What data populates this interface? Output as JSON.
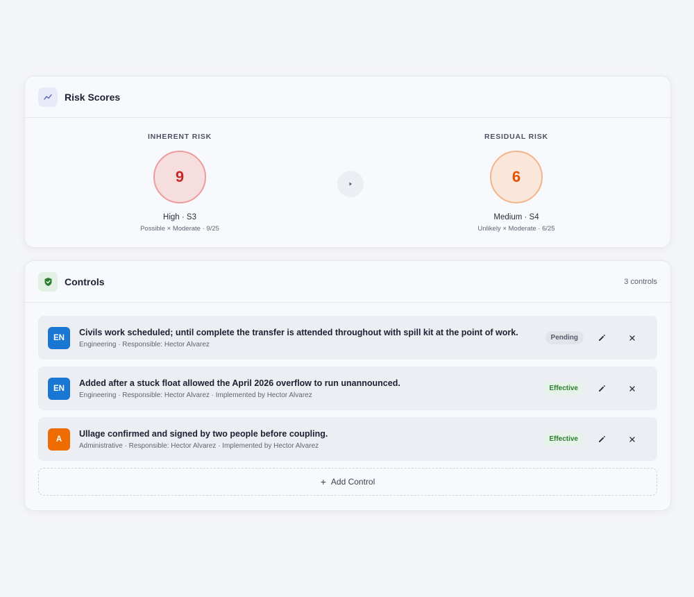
{
  "risk_scores": {
    "title": "Risk Scores",
    "header_icon": "trend-line-icon",
    "inherent": {
      "label": "INHERENT RISK",
      "score": "9",
      "level": "High · S3",
      "detail": "Possible × Moderate · 9/25",
      "color": "#c62828",
      "fill": "#f6dede",
      "ring": "#ec9c9c"
    },
    "residual": {
      "label": "RESIDUAL RISK",
      "score": "6",
      "level": "Medium · S4",
      "detail": "Unlikely × Moderate · 6/25",
      "color": "#e65100",
      "fill": "#fbe7da",
      "ring": "#f2b48a"
    },
    "arrow_icon": "play-arrow-icon"
  },
  "controls": {
    "title": "Controls",
    "header_icon": "shield-icon",
    "count": "3 controls",
    "items": [
      {
        "avatar": "EN",
        "avatar_color": "#1976d2",
        "title": "Civils work scheduled; until complete the transfer is attended throughout with spill kit at the point of work.",
        "meta": "Engineering · Responsible: Hector Alvarez",
        "status": "Pending"
      },
      {
        "avatar": "EN",
        "avatar_color": "#1976d2",
        "title": "Added after a stuck float allowed the April 2026 overflow to run unannounced.",
        "meta": "Engineering · Responsible: Hector Alvarez · Implemented by Hector Alvarez",
        "status": "Effective"
      },
      {
        "avatar": "A",
        "avatar_color": "#ef6c00",
        "title": "Ullage confirmed and signed by two people before coupling.",
        "meta": "Administrative · Responsible: Hector Alvarez · Implemented by Hector Alvarez",
        "status": "Effective"
      }
    ],
    "add_label": "Add Control",
    "add_icon": "+"
  }
}
